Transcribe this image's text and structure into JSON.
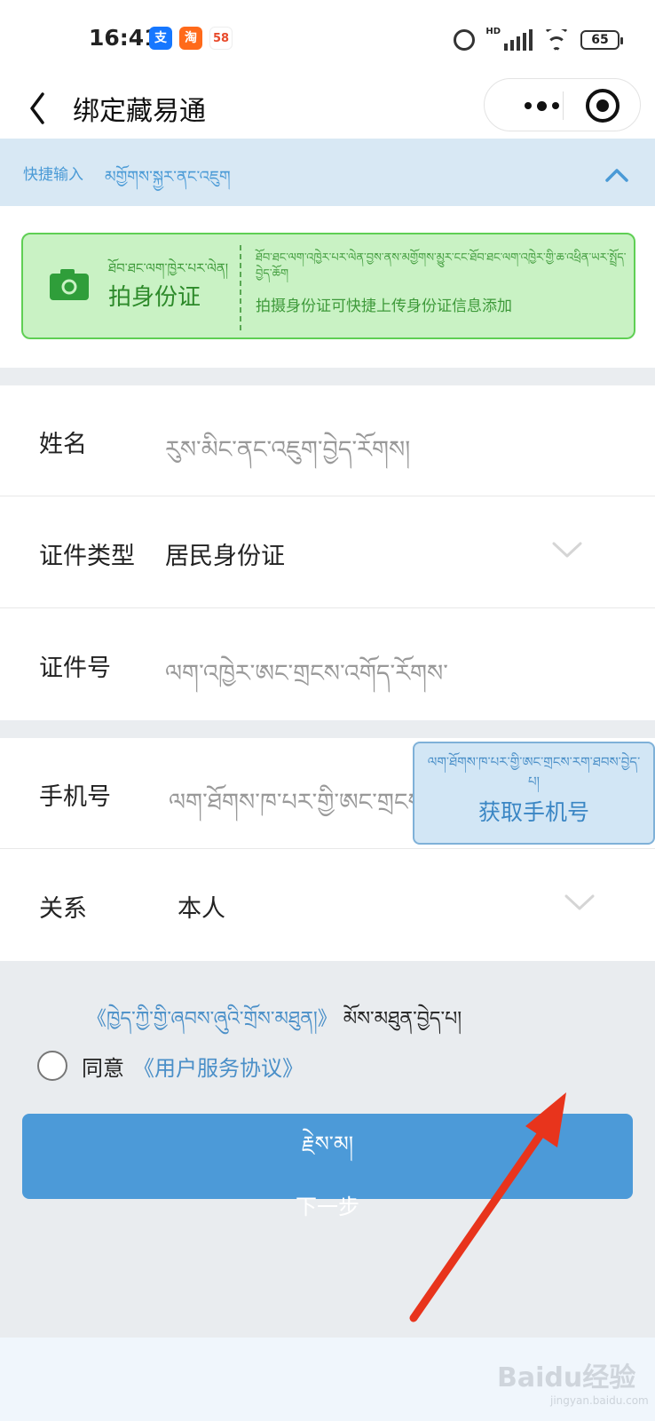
{
  "status_bar": {
    "time": "16:41",
    "app_icons": [
      {
        "name": "alipay-icon",
        "glyph": "支"
      },
      {
        "name": "taobao-icon",
        "glyph": "淘"
      },
      {
        "name": "58-app-icon",
        "glyph": "58"
      }
    ],
    "network": "HD",
    "battery": "65"
  },
  "header": {
    "title": "绑定藏易通"
  },
  "quick_input": {
    "label": "快捷输入",
    "label_tibetan": "མགྱོགས་སྐྱར་ནང་འཇུག"
  },
  "scan_card": {
    "label_tibetan": "ཐོབ་ཐང་ལག་ཁྱེར་པར་ལེན།",
    "label": "拍身份证",
    "desc_tibetan": "ཐོབ་ཐང་ལག་འཁྱེར་པར་ལེན་བྱས་ནས་མགྱོགས་མྱུར་ངང་ཐོབ་ཐང་ལག་འཁྱེར་གྱི་ཆ་འཕྲིན་ཡར་སྤྲོད་བྱེད་ཆོག",
    "desc": "拍摄身份证可快捷上传身份证信息添加"
  },
  "form": {
    "name": {
      "label": "姓名",
      "placeholder": "རུས་མིང་ནང་འཇུག་བྱེད་རོགས།"
    },
    "id_type": {
      "label": "证件类型",
      "value": "居民身份证"
    },
    "id_number": {
      "label": "证件号",
      "placeholder": "ལག་འཁྱེར་ཨང་གྲངས་འགོད་རོགས་"
    },
    "phone": {
      "label": "手机号",
      "placeholder": "ལག་ཐོགས་ཁ་པར་གྱི་ཨང་གྲངས་",
      "get_button_tibetan": "ལག་ཐོགས་ཁ་པར་གྱི་ཨང་གྲངས་རག་ཐབས་བྱེད་པ།",
      "get_button": "获取手机号"
    },
    "relation": {
      "label": "关系",
      "value": "本人"
    }
  },
  "agreement": {
    "link_tibetan": "《ཁྱེད་ཀྱི་གྱི་ཞབས་ཞུའི་གྲོས་མཐུན།》",
    "text_tibetan": "མོས་མཐུན་བྱེད་པ།",
    "agree_label": "同意",
    "link": "《用户服务协议》"
  },
  "next_button": {
    "label_tibetan": "རྗེས་མ།",
    "label": "下一步"
  },
  "watermark": {
    "text": "Baidu经验",
    "url": "jingyan.baidu.com"
  },
  "colors": {
    "accent_blue": "#4c9ad8",
    "scan_green": "#c9f2c4",
    "annotation_arrow": "#e8341c"
  }
}
